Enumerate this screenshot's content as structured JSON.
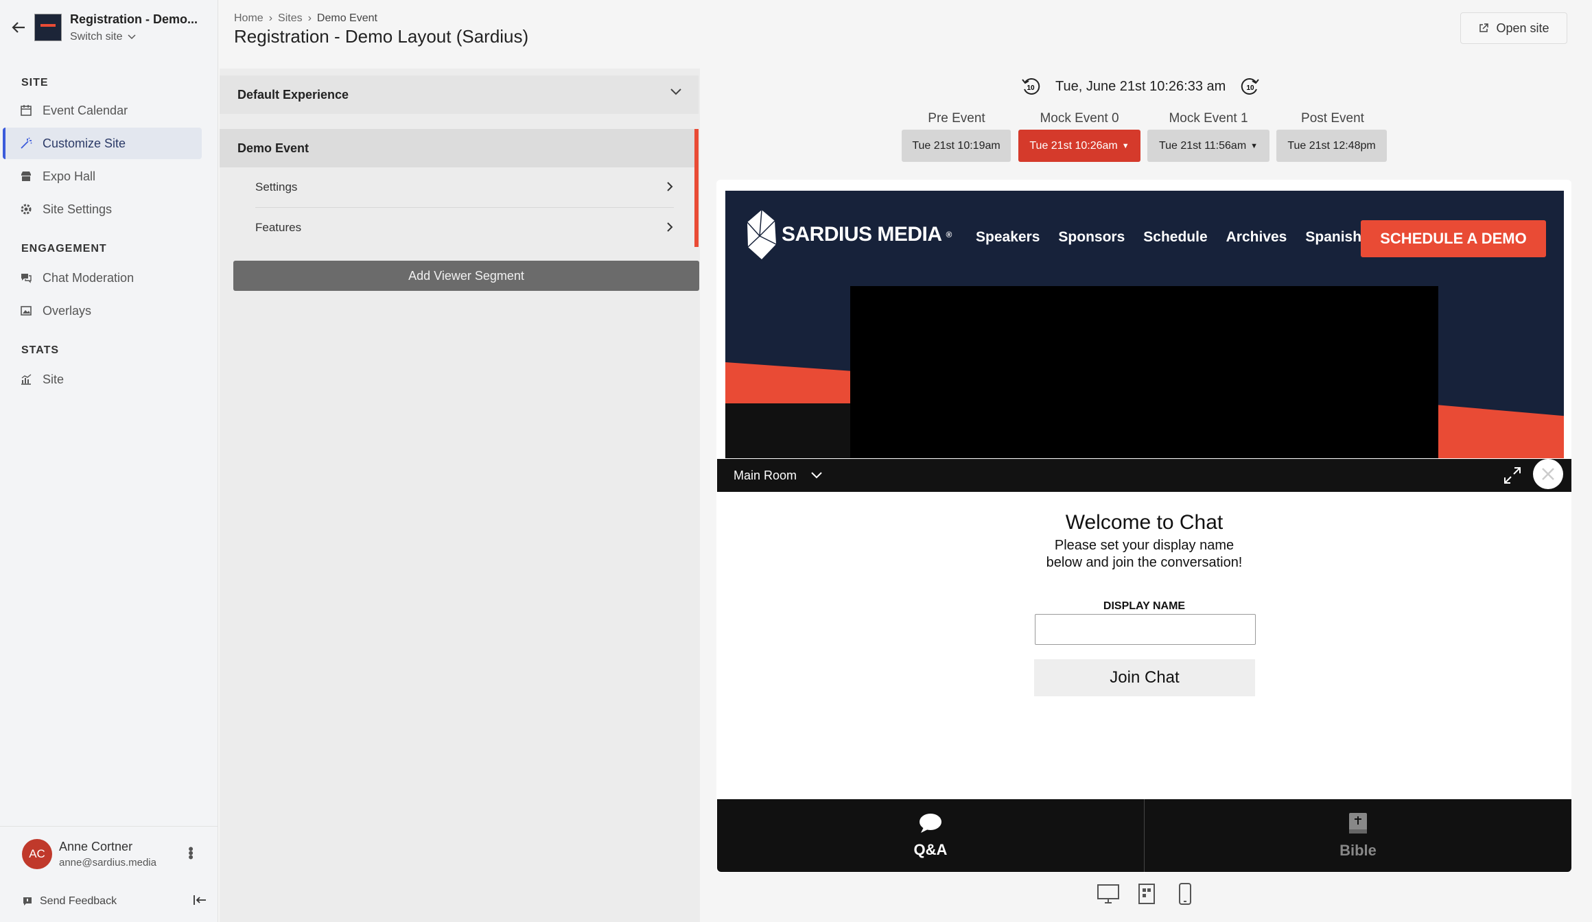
{
  "site": {
    "name": "Registration - Demo...",
    "switch_label": "Switch site"
  },
  "sidebar": {
    "sections": [
      {
        "title": "SITE",
        "items": [
          {
            "label": "Event Calendar",
            "icon": "calendar-icon"
          },
          {
            "label": "Customize Site",
            "icon": "wand-icon",
            "active": true
          },
          {
            "label": "Expo Hall",
            "icon": "store-icon"
          },
          {
            "label": "Site Settings",
            "icon": "gear-icon"
          }
        ]
      },
      {
        "title": "ENGAGEMENT",
        "items": [
          {
            "label": "Chat Moderation",
            "icon": "chat-icon"
          },
          {
            "label": "Overlays",
            "icon": "image-icon"
          }
        ]
      },
      {
        "title": "STATS",
        "items": [
          {
            "label": "Site",
            "icon": "stats-icon"
          }
        ]
      }
    ]
  },
  "user": {
    "initials": "AC",
    "name": "Anne Cortner",
    "email": "anne@sardius.media"
  },
  "feedback_label": "Send Feedback",
  "header": {
    "breadcrumb": [
      "Home",
      "Sites",
      "Demo Event"
    ],
    "title": "Registration - Demo Layout (Sardius)",
    "open_site_label": "Open site"
  },
  "experiences": {
    "default_label": "Default Experience",
    "demo_event_label": "Demo Event",
    "sub_items": [
      "Settings",
      "Features"
    ],
    "add_segment_label": "Add Viewer Segment"
  },
  "timeline": {
    "current_time": "Tue, June 21st 10:26:33 am",
    "skip_back_label": "10",
    "skip_forward_label": "10",
    "phases": [
      {
        "label": "Pre Event",
        "time": "Tue 21st 10:19am",
        "active": false,
        "caret": false
      },
      {
        "label": "Mock Event 0",
        "time": "Tue 21st 10:26am",
        "active": true,
        "caret": true
      },
      {
        "label": "Mock Event 1",
        "time": "Tue 21st 11:56am",
        "active": false,
        "caret": true
      },
      {
        "label": "Post Event",
        "time": "Tue 21st 12:48pm",
        "active": false,
        "caret": false
      }
    ]
  },
  "preview": {
    "logo_text": "SARDIUS MEDIA",
    "logo_mark": "®",
    "nav": [
      "Speakers",
      "Sponsors",
      "Schedule",
      "Archives",
      "Spanish"
    ],
    "cta": "SCHEDULE A DEMO",
    "room": "Main Room",
    "chat": {
      "title": "Welcome to Chat",
      "subtitle_line1": "Please set your display name",
      "subtitle_line2": "below and join the conversation!",
      "display_name_label": "DISPLAY NAME",
      "display_name_value": "",
      "join_label": "Join Chat"
    },
    "tabs": [
      {
        "label": "Q&A",
        "icon": "speech-bubble-icon",
        "active": true
      },
      {
        "label": "Bible",
        "icon": "book-icon",
        "active": false
      }
    ]
  },
  "colors": {
    "accent_red": "#e94b35",
    "active_phase": "#d53a2b",
    "hero_navy": "#17223a",
    "active_nav": "#3b5bdb"
  }
}
